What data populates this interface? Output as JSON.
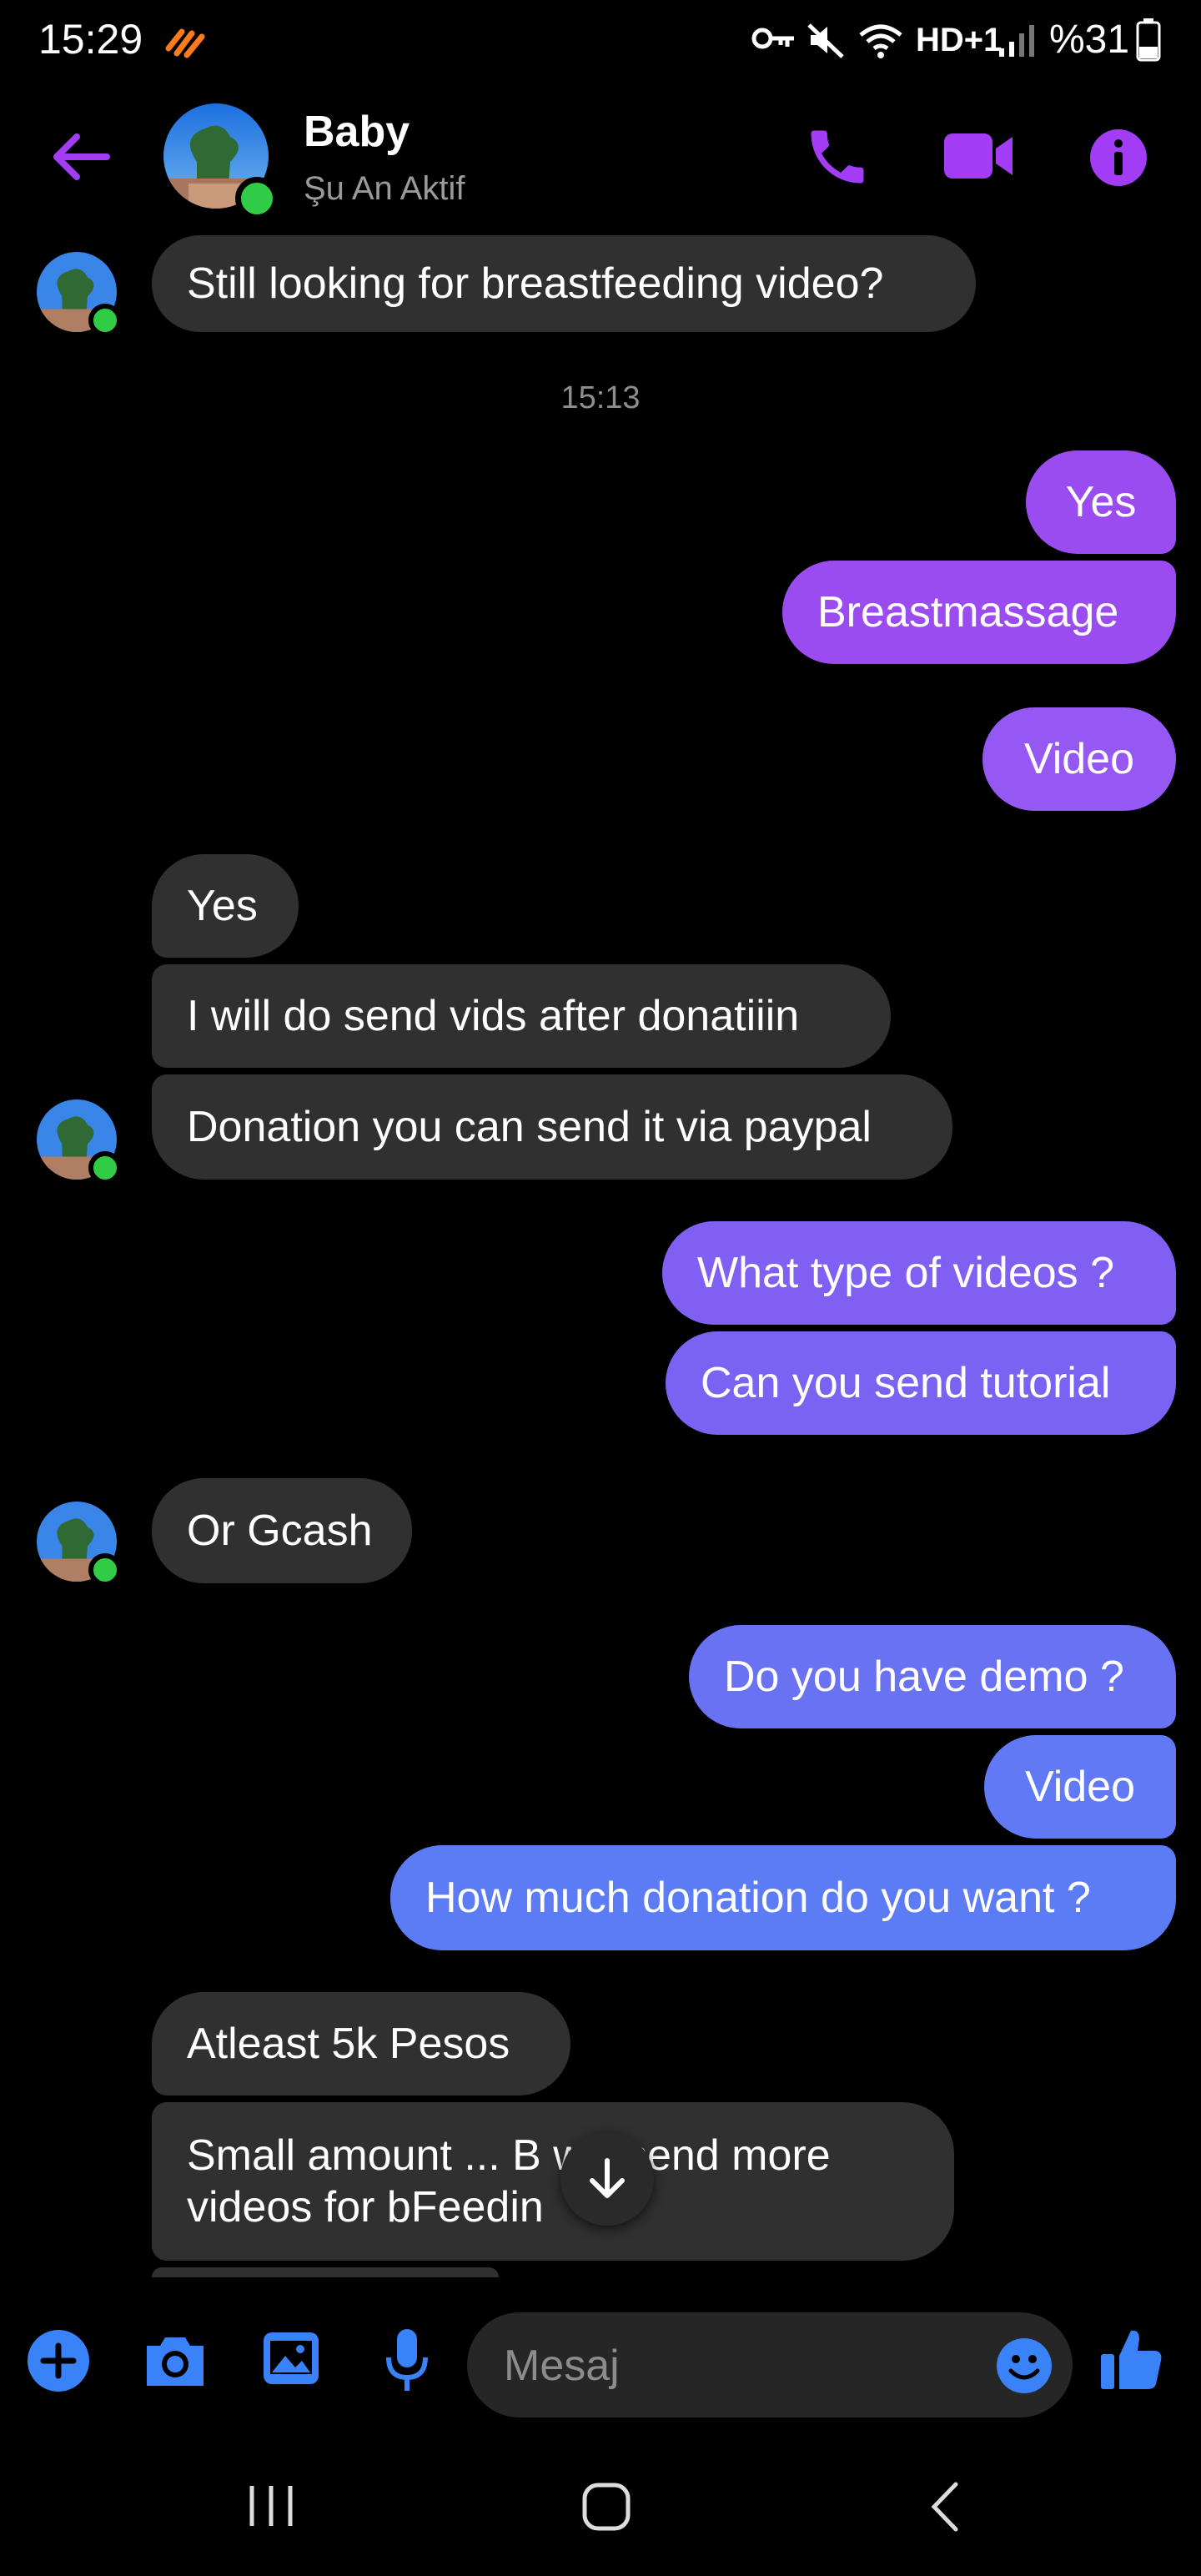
{
  "status_bar": {
    "time": "15:29",
    "battery": "%31",
    "network": "HD+1"
  },
  "header": {
    "contact_name": "Baby",
    "contact_status": "Şu An Aktif",
    "accent_color": "#a23cf5"
  },
  "messages": [
    {
      "side": "in",
      "text": "Still looking for breastfeeding video?"
    },
    {
      "type": "timestamp",
      "text": "15:13"
    },
    {
      "side": "out",
      "text": "Yes"
    },
    {
      "side": "out",
      "text": "Breastmassage"
    },
    {
      "side": "out",
      "text": "Video"
    },
    {
      "side": "in",
      "text": "Yes"
    },
    {
      "side": "in",
      "text": "I will do send vids after donatiiin"
    },
    {
      "side": "in",
      "text": "Donation you can send it via paypal"
    },
    {
      "side": "out",
      "text": "What type of videos ?"
    },
    {
      "side": "out",
      "text": "Can you send tutorial"
    },
    {
      "side": "in",
      "text": "Or Gcash"
    },
    {
      "side": "out",
      "text": "Do you have demo ?"
    },
    {
      "side": "out",
      "text": "Video"
    },
    {
      "side": "out",
      "text": "How much donation do you want ?"
    },
    {
      "side": "in",
      "text": "Atleast 5k Pesos"
    },
    {
      "side": "in",
      "text_line1": "Small amount ... B  will send more",
      "text_line2": "videos for bFeedin"
    }
  ],
  "composer": {
    "placeholder": "Mesaj",
    "icons": [
      "plus-icon",
      "camera-icon",
      "gallery-icon",
      "microphone-icon",
      "emoji-icon",
      "thumbs-up-icon"
    ]
  },
  "colors": {
    "bubble_in": "#303030",
    "out_purple": "#9b4cf0",
    "out_blue_purple": "#7a63f3",
    "out_blue": "#5b7cf5",
    "composer_blue": "#3a82f7",
    "online_green": "#31cc46"
  }
}
